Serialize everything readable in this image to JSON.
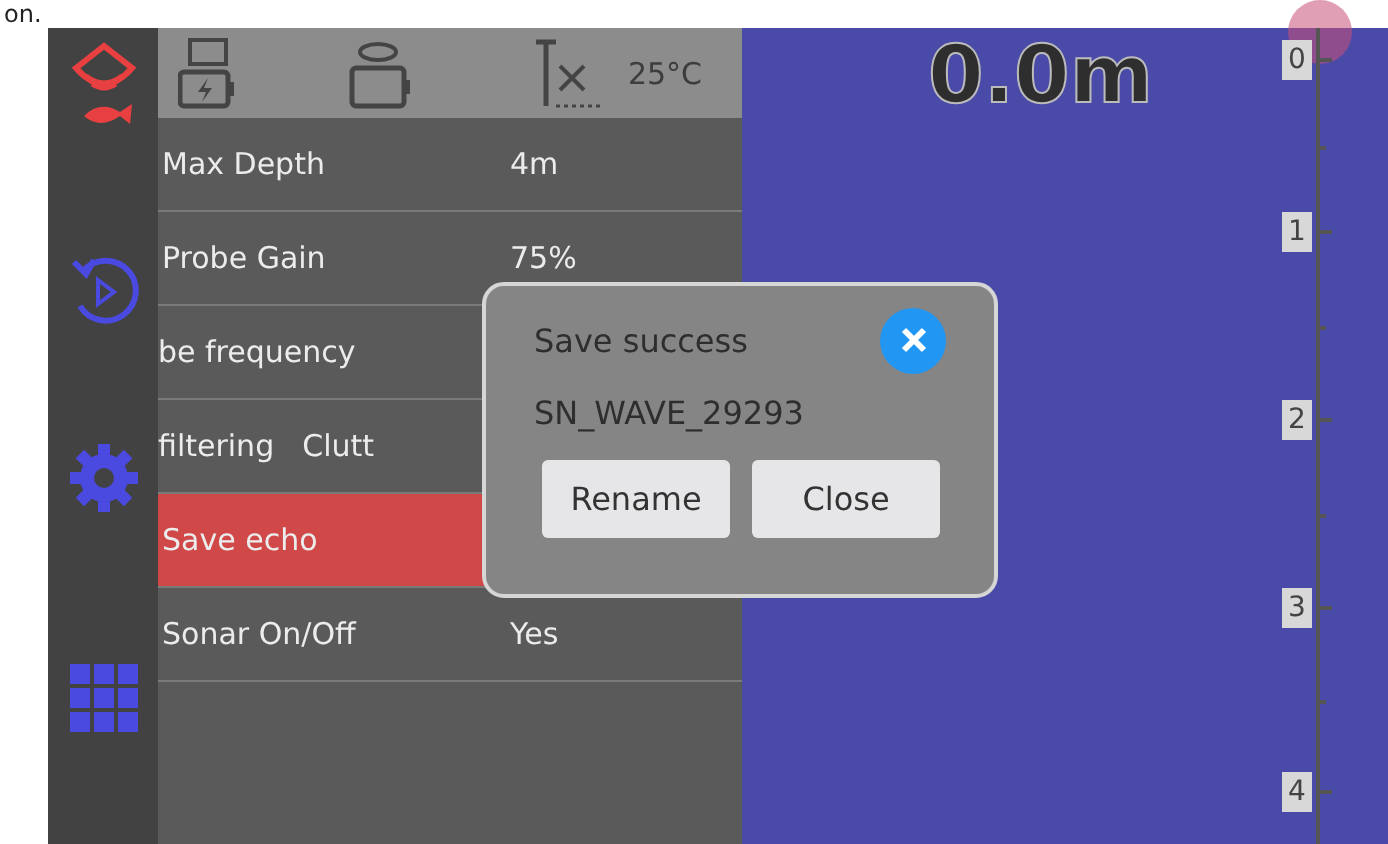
{
  "caption_fragment": "on.",
  "status_bar": {
    "temperature": "25°C"
  },
  "menu": [
    {
      "label": "Max Depth",
      "value": "4m",
      "kind": "fixed",
      "selected": false
    },
    {
      "label": "Probe Gain",
      "value": "75%",
      "kind": "fixed",
      "selected": false
    },
    {
      "label": "be frequency",
      "kind": "scrolling",
      "selected": false
    },
    {
      "label": "filtering",
      "value": "Clutt",
      "kind": "scrolling",
      "selected": false
    },
    {
      "label": "Save echo",
      "kind": "fixed",
      "selected": true
    },
    {
      "label": "Sonar On/Off",
      "value": "Yes",
      "kind": "fixed",
      "selected": false
    }
  ],
  "depth_reading": "0.0m",
  "depth_scale": [
    "0",
    "1",
    "2",
    "3",
    "4"
  ],
  "dialog": {
    "title": "Save success",
    "filename": "SN_WAVE_29293",
    "buttons": [
      "Rename",
      "Close"
    ]
  }
}
